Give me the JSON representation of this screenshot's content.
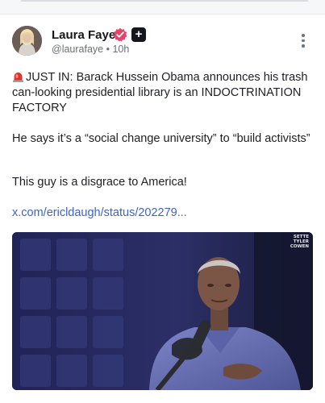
{
  "post": {
    "author": {
      "name": "Laura Faye",
      "handle": "@laurafaye",
      "separator": "•",
      "time": "10h"
    },
    "badges": {
      "verified_icon": "verified-flower-badge",
      "plus_icon": "plus-badge",
      "plus_symbol": "+"
    },
    "menu_icon": "vertical-ellipsis-icon",
    "paragraph1": "JUST IN: Barack Hussein Obama announces his trash can-looking presidential library is an INDOCTRINATION FACTORY",
    "paragraph1_icon": "rotating-light-emoji",
    "paragraph2": "He says it’s a “social change university” to “build activists”",
    "paragraph3": "This guy is a disgrace to America!",
    "link": "x.com/ericldaugh/status/202279...",
    "media": {
      "watermark_lines": [
        "SETTE",
        "TYLER",
        "COWEN"
      ]
    }
  },
  "colors": {
    "link": "#3e63c9",
    "verified": "#e8436b",
    "media_background": "#1a1e47"
  }
}
